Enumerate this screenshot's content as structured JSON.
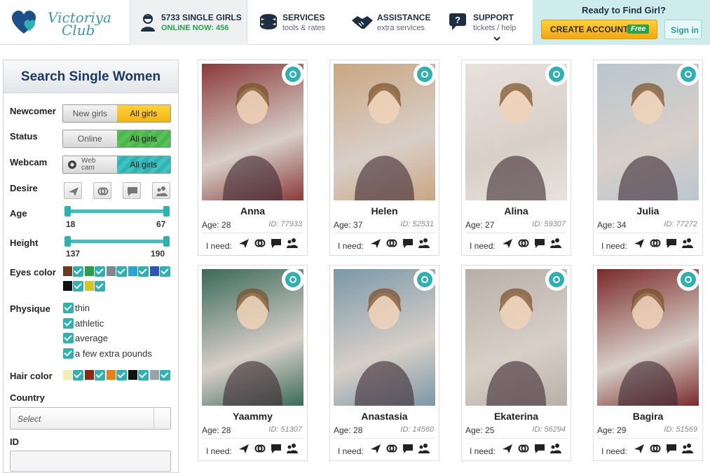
{
  "brand": {
    "line1": "Victoriya",
    "line2": "Club",
    "heart_color": "#1d4f8a",
    "accent": "#2fb1b1"
  },
  "nav": {
    "online_title": "5733 SINGLE GIRLS",
    "online_sub": "ONLINE NOW: 456",
    "services_title": "SERVICES",
    "services_sub": "tools & rates",
    "assist_title": "ASSISTANCE",
    "assist_sub": "extra services",
    "support_title": "SUPPORT",
    "support_sub": "tickets / help"
  },
  "cta": {
    "title": "Ready to Find Girl?",
    "create": "CREATE ACCOUNT",
    "free": "Free",
    "signin": "Sign in"
  },
  "sidebar": {
    "title": "Search Single Women",
    "newcomer_label": "Newcomer",
    "newcomer_opts": [
      "New girls",
      "All girls"
    ],
    "status_label": "Status",
    "status_opts": [
      "Online",
      "All girls"
    ],
    "webcam_label": "Webcam",
    "webcam_opts": [
      "Web cam",
      "All girls"
    ],
    "desire_label": "Desire",
    "desire_icons": [
      "plane-icon",
      "rings-icon",
      "chat-icon",
      "people-icon"
    ],
    "age_label": "Age",
    "age_min": "18",
    "age_max": "67",
    "height_label": "Height",
    "height_min": "137",
    "height_max": "190",
    "eyes_label": "Eyes color",
    "eye_colors": [
      "#6b3a1e",
      "#2f9d44",
      "#7f8790",
      "#2aa5d8",
      "#2e55b8",
      "#111111",
      "#d6c324"
    ],
    "physique_label": "Physique",
    "physique": [
      "thin",
      "athletic",
      "average",
      "a few extra pounds"
    ],
    "hair_label": "Hair color",
    "hair_colors": [
      "#f5edb0",
      "#8a2a12",
      "#e8801a",
      "#111111",
      "#9aa3a8"
    ],
    "country_label": "Country",
    "country_placeholder": "Select",
    "id_label": "ID"
  },
  "need_label": "I need:",
  "age_prefix": "Age:",
  "id_prefix": "ID:",
  "profiles": [
    {
      "name": "Anna",
      "age": "28",
      "id": "77933",
      "color": "#8a3a3a"
    },
    {
      "name": "Helen",
      "age": "37",
      "id": "52531",
      "color": "#c9a682"
    },
    {
      "name": "Alina",
      "age": "27",
      "id": "59307",
      "color": "#e8e2dc"
    },
    {
      "name": "Julia",
      "age": "34",
      "id": "77272",
      "color": "#b9c6cf"
    },
    {
      "name": "Yaammy",
      "age": "28",
      "id": "51307",
      "color": "#3a6a5a"
    },
    {
      "name": "Anastasia",
      "age": "28",
      "id": "14560",
      "color": "#7a98a8"
    },
    {
      "name": "Ekaterina",
      "age": "25",
      "id": "56294",
      "color": "#b8b0a8"
    },
    {
      "name": "Bagira",
      "age": "29",
      "id": "51569",
      "color": "#7a2a2a"
    }
  ]
}
